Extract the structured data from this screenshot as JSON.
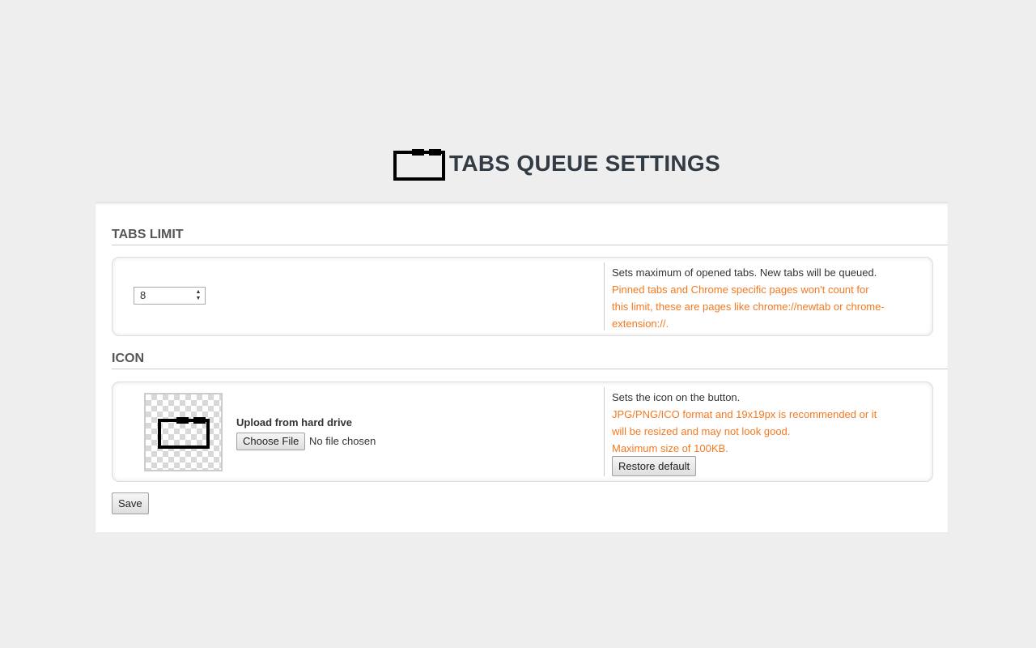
{
  "header": {
    "title": "TABS QUEUE SETTINGS",
    "logo_icon": "tabs-queue-icon"
  },
  "tabs_limit": {
    "section_title": "TABS LIMIT",
    "value": "8",
    "description": "Sets maximum of opened tabs. New tabs will be queued.",
    "note": "Pinned tabs and Chrome specific pages won't count for this limit, these are pages like chrome://newtab or chrome-extension://."
  },
  "icon": {
    "section_title": "ICON",
    "upload_label": "Upload from hard drive",
    "choose_file_label": "Choose File",
    "file_status": "No file chosen",
    "description": "Sets the icon on the button.",
    "note_format": "JPG/PNG/ICO format and 19x19px is recommended or it will be resized and may not look good.",
    "note_size": "Maximum size of 100KB.",
    "restore_label": "Restore default"
  },
  "actions": {
    "save_label": "Save"
  },
  "colors": {
    "background": "#eeeeee",
    "panel": "#ffffff",
    "title": "#333b45",
    "warning": "#f47920"
  }
}
